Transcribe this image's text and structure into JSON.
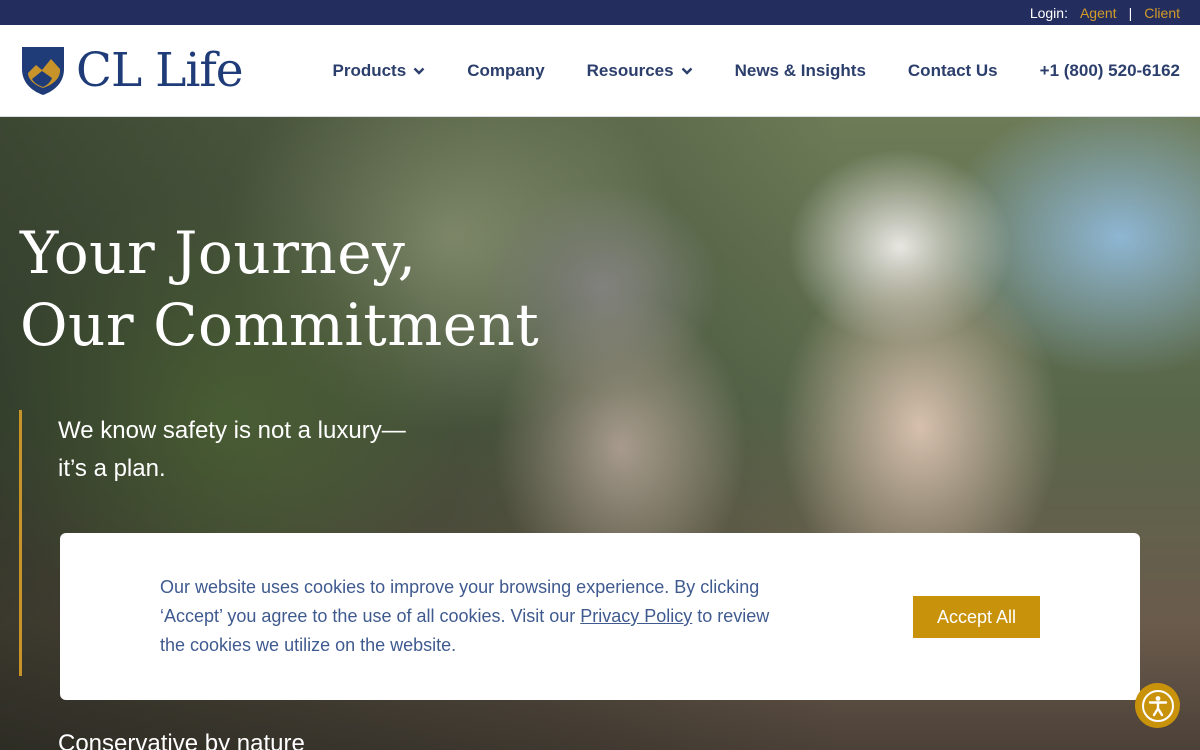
{
  "topbar": {
    "login_label": "Login:",
    "agent_link": "Agent",
    "separator": "|",
    "client_link": "Client"
  },
  "header": {
    "logo_text": "CL Life",
    "nav": [
      {
        "label": "Products",
        "has_dropdown": true,
        "icon": "chevron-down-icon"
      },
      {
        "label": "Company",
        "has_dropdown": false
      },
      {
        "label": "Resources",
        "has_dropdown": true,
        "icon": "chevron-down-icon"
      },
      {
        "label": "News & Insights",
        "has_dropdown": false
      },
      {
        "label": "Contact Us",
        "has_dropdown": false
      },
      {
        "label": "+1 (800) 520-6162",
        "has_dropdown": false
      }
    ]
  },
  "hero": {
    "title_line1": "Your Journey,",
    "title_line2": "Our Commitment",
    "tagline_line1": "We know safety is not a luxury—",
    "tagline_line2": "it’s a plan.",
    "bottom_text": "Conservative by nature"
  },
  "cookie_banner": {
    "message_part1": "Our website uses cookies to improve your browsing experience. By clicking ‘Accept’ you agree to the use of all cookies. Visit our ",
    "privacy_link": "Privacy Policy",
    "message_part2": " to review the cookies we utilize on the website.",
    "accept_label": "Accept All"
  },
  "accessibility": {
    "icon": "accessibility-icon"
  },
  "colors": {
    "topbar_bg": "#242e5e",
    "brand_navy": "#1f3c78",
    "accent_gold": "#c8920b",
    "nav_text": "#2c3f6c",
    "cookie_text": "#3f5a8f"
  }
}
